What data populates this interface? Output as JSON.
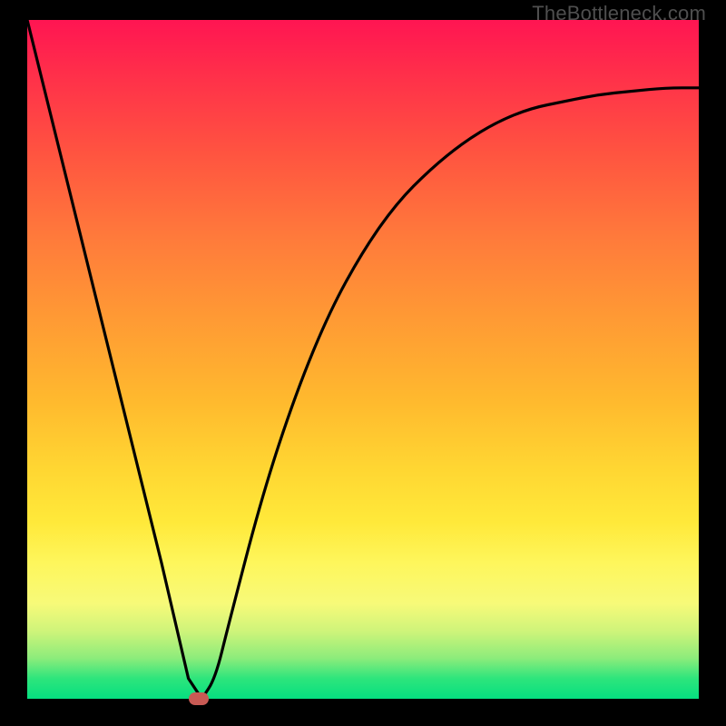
{
  "brand": "TheBottleneck.com",
  "colors": {
    "frame_bg": "#000000",
    "gradient_top": "#ff1552",
    "gradient_bottom": "#05df80",
    "curve": "#000000",
    "marker": "#c85a54",
    "brand_text": "#4f4f4f"
  },
  "chart_data": {
    "type": "line",
    "title": "",
    "xlabel": "",
    "ylabel": "",
    "xlim": [
      0,
      1
    ],
    "ylim": [
      0,
      1
    ],
    "x": [
      0.0,
      0.05,
      0.1,
      0.15,
      0.2,
      0.24,
      0.26,
      0.28,
      0.3,
      0.35,
      0.4,
      0.45,
      0.5,
      0.55,
      0.6,
      0.65,
      0.7,
      0.75,
      0.8,
      0.85,
      0.9,
      0.95,
      1.0
    ],
    "values": [
      1.0,
      0.8,
      0.6,
      0.4,
      0.2,
      0.03,
      0.0,
      0.03,
      0.11,
      0.3,
      0.45,
      0.57,
      0.66,
      0.73,
      0.78,
      0.82,
      0.85,
      0.87,
      0.88,
      0.89,
      0.895,
      0.9,
      0.9
    ],
    "annotations": [
      {
        "type": "marker",
        "x": 0.255,
        "y": 0.0,
        "shape": "pill"
      }
    ],
    "note": "V-shaped curve: steep linear descent to a minimum near x≈0.26, then a rising concave curve approaching ~0.90."
  }
}
